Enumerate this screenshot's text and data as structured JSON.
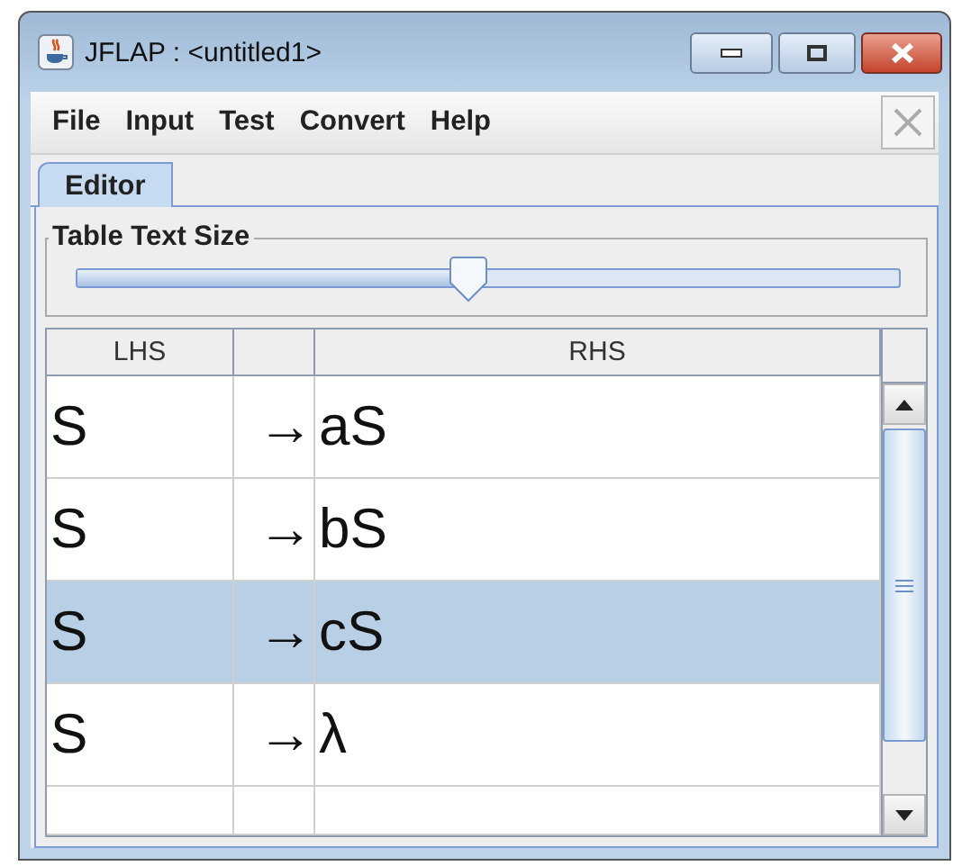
{
  "window": {
    "title": "JFLAP : <untitled1>"
  },
  "menu": [
    "File",
    "Input",
    "Test",
    "Convert",
    "Help"
  ],
  "tabs": [
    {
      "label": "Editor",
      "selected": true
    }
  ],
  "text_size": {
    "title": "Table Text Size",
    "level": 0.476
  },
  "table": {
    "columns": [
      "LHS",
      "",
      "RHS"
    ],
    "rows": [
      {
        "lhs": "S",
        "arrow": "→",
        "rhs": "aS",
        "selected": false
      },
      {
        "lhs": "S",
        "arrow": "→",
        "rhs": "bS",
        "selected": false
      },
      {
        "lhs": "S",
        "arrow": "→",
        "rhs": "cS",
        "selected": true
      },
      {
        "lhs": "S",
        "arrow": "→",
        "rhs": "λ",
        "selected": false
      }
    ]
  }
}
